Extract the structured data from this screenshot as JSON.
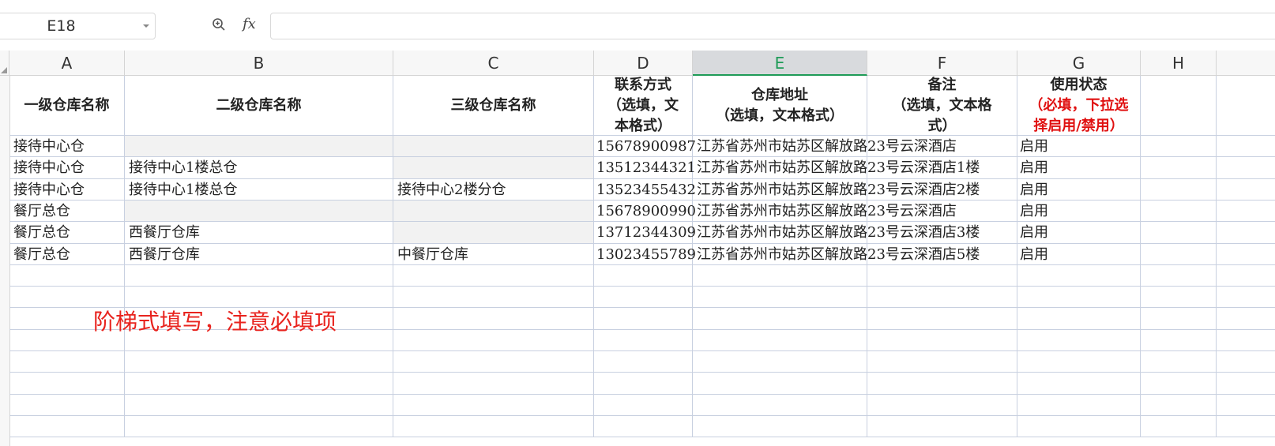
{
  "formula_bar": {
    "cell_ref": "E18",
    "fx_label": "fx",
    "formula_value": ""
  },
  "columns": [
    "A",
    "B",
    "C",
    "D",
    "E",
    "F",
    "G",
    "H"
  ],
  "selected_column": "E",
  "headers": {
    "a": "一级仓库名称",
    "b": "二级仓库名称",
    "c": "三级仓库名称",
    "d_line1": "联系方式",
    "d_line2": "（选填，文",
    "d_line3": "本格式）",
    "e_line1": "仓库地址",
    "e_line2": "（选填，文本格式）",
    "f_line1": "备注",
    "f_line2": "（选填，文本格",
    "f_line3": "式）",
    "g_line1": "使用状态",
    "g_line2": "（必填，下拉选",
    "g_line3": "择启用/禁用）"
  },
  "rows": [
    {
      "a": "接待中心仓",
      "b": "",
      "c": "",
      "d": "15678900987",
      "e": "江苏省苏州市姑苏区解放路23号云深酒店",
      "g": "启用"
    },
    {
      "a": "接待中心仓",
      "b": "接待中心1楼总仓",
      "c": "",
      "d": "13512344321",
      "e": "江苏省苏州市姑苏区解放路23号云深酒店1楼",
      "g": "启用"
    },
    {
      "a": "接待中心仓",
      "b": "接待中心1楼总仓",
      "c": "接待中心2楼分仓",
      "d": "13523455432",
      "e": "江苏省苏州市姑苏区解放路23号云深酒店2楼",
      "g": "启用"
    },
    {
      "a": "餐厅总仓",
      "b": "",
      "c": "",
      "d": "15678900990",
      "e": "江苏省苏州市姑苏区解放路23号云深酒店",
      "g": "启用"
    },
    {
      "a": "餐厅总仓",
      "b": "西餐厅仓库",
      "c": "",
      "d": "13712344309",
      "e": "江苏省苏州市姑苏区解放路23号云深酒店3楼",
      "g": "启用"
    },
    {
      "a": "餐厅总仓",
      "b": "西餐厅仓库",
      "c": "中餐厅仓库",
      "d": "13023455789",
      "e": "江苏省苏州市姑苏区解放路23号云深酒店5楼",
      "g": "启用"
    }
  ],
  "annotation": "阶梯式填写，注意必填项",
  "colors": {
    "accent_green": "#1e9b57",
    "required_red": "#e01010",
    "note_red": "#e8231e",
    "empty_cell_gray": "#f2f2f2"
  }
}
